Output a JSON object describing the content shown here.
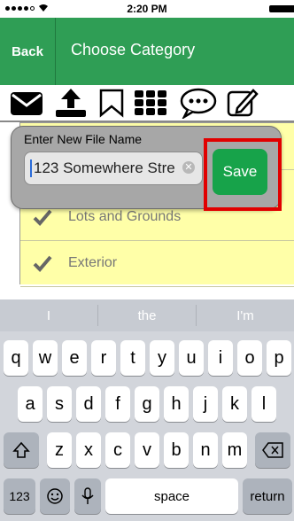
{
  "status": {
    "time": "2:20 PM"
  },
  "nav": {
    "back_label": "Back",
    "title": "Choose Category"
  },
  "toolbar": {
    "icons": [
      "envelope-icon",
      "upload-icon",
      "bookmark-icon",
      "grid-icon",
      "chat-bubble-icon",
      "edit-icon"
    ]
  },
  "list": {
    "items": [
      {
        "label": "Lots and Grounds"
      },
      {
        "label": "Exterior"
      }
    ]
  },
  "popup": {
    "label": "Enter New File Name",
    "input_value": "123 Somewhere Stre",
    "save_label": "Save"
  },
  "keyboard": {
    "predictions": [
      "I",
      "the",
      "I'm"
    ],
    "row1": [
      "q",
      "w",
      "e",
      "r",
      "t",
      "y",
      "u",
      "i",
      "o",
      "p"
    ],
    "row2": [
      "a",
      "s",
      "d",
      "f",
      "g",
      "h",
      "j",
      "k",
      "l"
    ],
    "row3": [
      "z",
      "x",
      "c",
      "v",
      "b",
      "n",
      "m"
    ],
    "numbers_label": "123",
    "space_label": "space",
    "return_label": "return"
  },
  "colors": {
    "nav_green": "#2f9e55",
    "save_green": "#17a34a",
    "highlight_red": "#e10000",
    "list_yellow": "#ffffa8"
  }
}
